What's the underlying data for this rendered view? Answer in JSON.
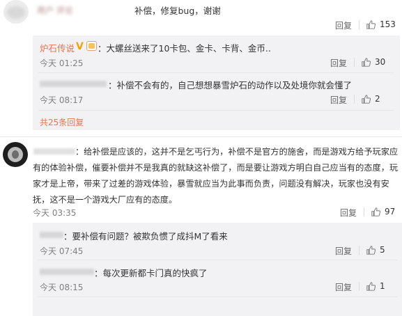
{
  "top_comment": {
    "username": "用户 评论",
    "text": "补偿，修复bug，谢谢",
    "reply_label": "回复",
    "likes": "153"
  },
  "reply1": {
    "author": "炉石传说",
    "text": "：大螺丝送来了10卡包、金卡、卡背、金币..",
    "time": "今天 01:25",
    "reply_label": "回复",
    "likes": "30"
  },
  "reply2": {
    "text": "：补偿不会有的，自己想想暴雪炉石的动作以及处境你就会懂了",
    "time": "今天 08:17",
    "reply_label": "回复",
    "likes": "2"
  },
  "more_replies": "共25条回复",
  "comment2": {
    "lines": [
      "：给补偿是应该的，这并不是乞丐行为，补偿不是官方的施舍，而是游戏方给予玩家应",
      "有的体验补偿，催要补偿并不是我真的就缺这补偿了，而是要让游戏方明白自己应当有的态度，玩",
      "家才是上帝，带来了过差的游戏体验，暴雪就应当为此事而负责，问题没有解决，玩家也没有安",
      "抚，这不是一个游戏大厂应有的态度。"
    ],
    "time": "今天 03:35",
    "reply_label": "回复",
    "likes": "97"
  },
  "reply3": {
    "text": "：要补偿有问题？被欺负惯了成抖M了看来",
    "time": "今天 07:45",
    "reply_label": "回复",
    "likes": "5"
  },
  "reply4": {
    "text": "：每次更新都卡门真的快疯了",
    "time": "今天 08:15",
    "reply_label": "回复",
    "likes": "1"
  },
  "colors": {
    "accent": "#eb7350",
    "reply_bg": "#f2f2f5"
  }
}
